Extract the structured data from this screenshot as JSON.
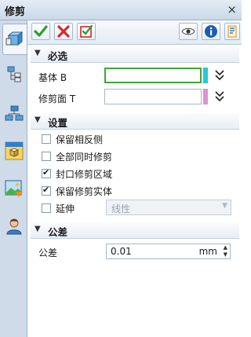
{
  "window": {
    "title": "修剪",
    "close_glyph": "×"
  },
  "left_toolbar": [
    {
      "name": "feature-icon",
      "active": true
    },
    {
      "name": "tree-icon"
    },
    {
      "name": "hierarchy-icon"
    },
    {
      "name": "view-icon"
    },
    {
      "name": "image-icon"
    },
    {
      "name": "user-icon"
    }
  ],
  "top_toolbar": {
    "confirm_icon": "check-icon",
    "cancel_icon": "x-icon",
    "apply_icon": "apply-icon",
    "preview_icon": "eye-icon",
    "info_icon": "info-icon",
    "help_icon": "help-icon"
  },
  "sections": {
    "required": {
      "title": "必选",
      "base_label": "基体 B",
      "trim_label": "修剪面 T",
      "base_color": "#27c9d3",
      "trim_color": "#e18fd9"
    },
    "settings": {
      "title": "设置",
      "options": [
        {
          "label": "保留相反侧",
          "checked": false
        },
        {
          "label": "全部同时修剪",
          "checked": false
        },
        {
          "label": "封口修剪区域",
          "checked": true
        },
        {
          "label": "保留修剪实体",
          "checked": true
        },
        {
          "label": "延伸",
          "checked": false
        }
      ],
      "extend_type_value": "线性"
    },
    "tolerance": {
      "title": "公差",
      "label": "公差",
      "value": "0.01",
      "unit": "mm"
    }
  },
  "colors": {
    "accent_green": "#3ea63a",
    "header_bg": "#cfdbe8"
  }
}
